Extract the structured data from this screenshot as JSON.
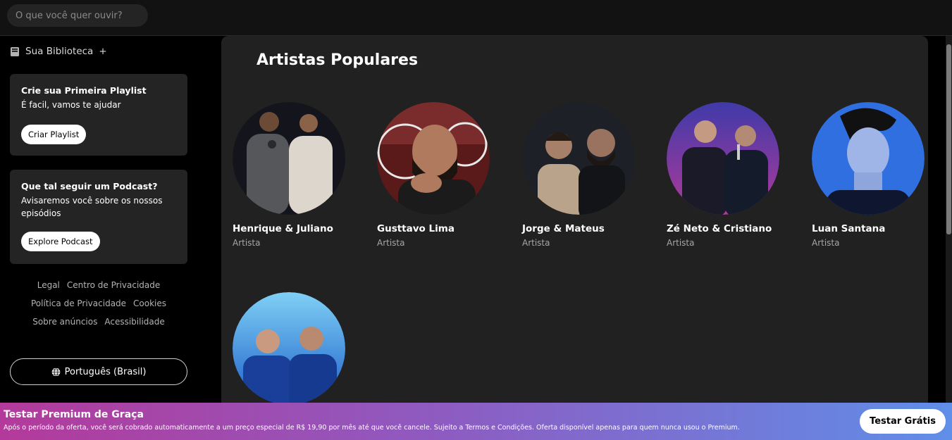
{
  "search": {
    "placeholder": "O que você quer ouvir?"
  },
  "sidebar": {
    "library_label": "Sua Biblioteca",
    "library_add": "+",
    "playlist_card": {
      "title": "Crie sua Primeira Playlist",
      "subtitle": "É facil, vamos te ajudar",
      "button": "Criar Playlist"
    },
    "podcast_card": {
      "title": "Que tal seguir um Podcast?",
      "subtitle": "Avisaremos você sobre os nossos episódios",
      "button": "Explore Podcast"
    },
    "links": [
      "Legal",
      "Centro de Privacidade",
      "Política de Privacidade",
      "Cookies",
      "Sobre anúncios",
      "Acessibilidade"
    ],
    "language_button": "Português (Brasil)"
  },
  "main": {
    "title": "Artistas Populares",
    "artists": [
      {
        "name": "Henrique & Juliano",
        "role": "Artista"
      },
      {
        "name": "Gusttavo Lima",
        "role": "Artista"
      },
      {
        "name": "Jorge & Mateus",
        "role": "Artista"
      },
      {
        "name": "Zé Neto & Cristiano",
        "role": "Artista"
      },
      {
        "name": "Luan Santana",
        "role": "Artista"
      },
      {
        "name": "",
        "role": ""
      }
    ]
  },
  "banner": {
    "title": "Testar Premium de Graça",
    "subtitle": "Após o período da oferta, você será cobrado automaticamente a um preço especial de R$ 19,90 por mês até que você cancele. Sujeito a Termos e Condições. Oferta disponível apenas para quem nunca usou o Premium.",
    "button": "Testar  Grátis"
  },
  "colors": {
    "background": "#000000",
    "panel": "#212121",
    "card": "#242424",
    "banner_start": "#b33a9b",
    "banner_end": "#5f8ee8"
  }
}
